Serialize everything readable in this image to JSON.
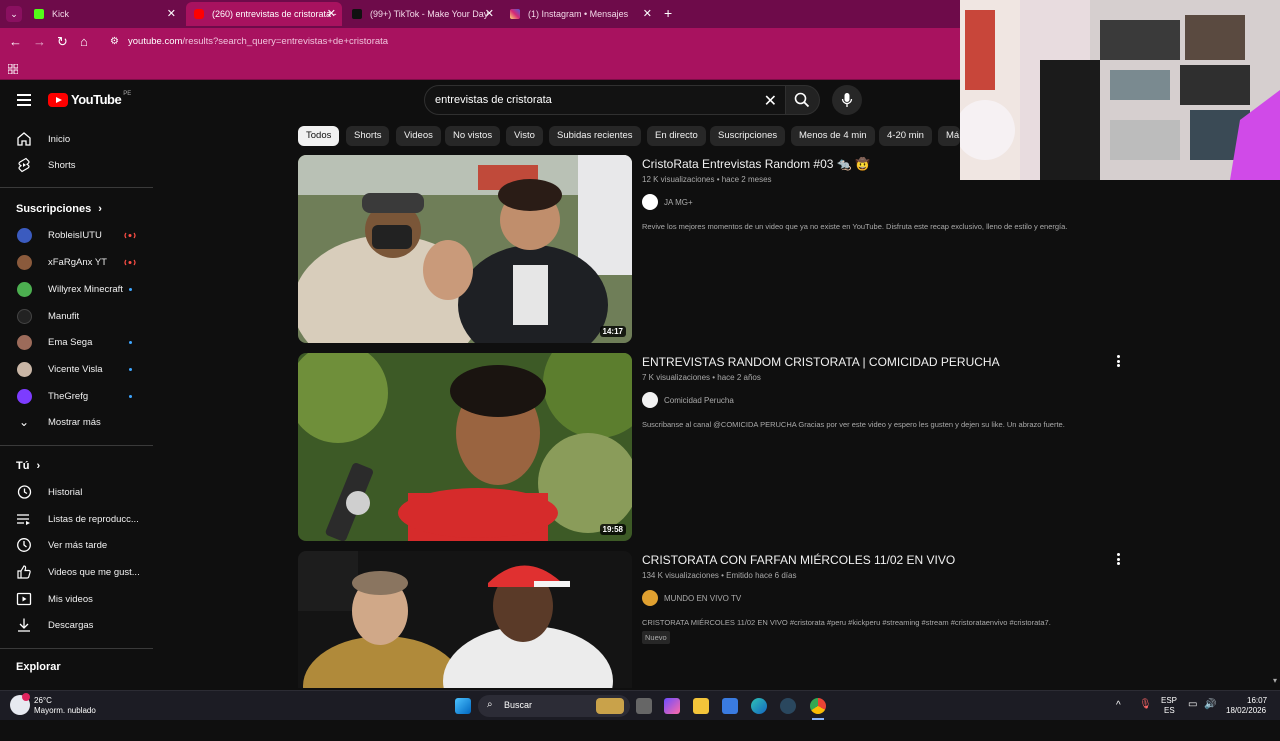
{
  "browser": {
    "tabs": [
      {
        "label": "Kick",
        "active": false,
        "icon_color": "#53fc18"
      },
      {
        "label": "(260) entrevistas de cristorata -",
        "active": true,
        "icon_color": "#ff0000"
      },
      {
        "label": "(99+) TikTok - Make Your Day",
        "active": false,
        "icon_color": "#000000"
      },
      {
        "label": "(1) Instagram • Mensajes",
        "active": false,
        "icon_color": "#d62976"
      }
    ],
    "new_tab": "+",
    "url_host": "youtube.com",
    "url_path": "/results?search_query=entrevistas+de+cristorata",
    "theme_color": "#a8125f"
  },
  "header": {
    "logo_text": "YouTube",
    "region": "PE",
    "search_query": "entrevistas de cristorata"
  },
  "sidebar": {
    "top_items": [
      {
        "label": "Inicio",
        "icon": "home-icon"
      },
      {
        "label": "Shorts",
        "icon": "shorts-icon"
      }
    ],
    "subscriptions_title": "Suscripciones",
    "subscriptions": [
      {
        "label": "RobleisIUTU",
        "indicator": "live",
        "avatar_color": "#3b5bbf"
      },
      {
        "label": "xFaRgAnx YT",
        "indicator": "live",
        "avatar_color": "#8a5a3c"
      },
      {
        "label": "Willyrex Minecraft",
        "indicator": "dot",
        "avatar_color": "#4caf50"
      },
      {
        "label": "Manufit",
        "indicator": "",
        "avatar_color": "#222222"
      },
      {
        "label": "Ema Sega",
        "indicator": "dot",
        "avatar_color": "#9c6b5a"
      },
      {
        "label": "Vicente Visla",
        "indicator": "dot",
        "avatar_color": "#c9b6a6"
      },
      {
        "label": "TheGrefg",
        "indicator": "dot",
        "avatar_color": "#7d3cff"
      },
      {
        "label": "Mostrar más",
        "indicator": "",
        "avatar_color": ""
      }
    ],
    "you_title": "Tú",
    "you_items": [
      {
        "label": "Historial",
        "icon": "history-icon"
      },
      {
        "label": "Listas de reproducc...",
        "icon": "playlists-icon"
      },
      {
        "label": "Ver más tarde",
        "icon": "watch-later-icon"
      },
      {
        "label": "Videos que me gust...",
        "icon": "like-icon"
      },
      {
        "label": "Mis videos",
        "icon": "my-videos-icon"
      },
      {
        "label": "Descargas",
        "icon": "downloads-icon"
      }
    ],
    "explore_title": "Explorar"
  },
  "chips": [
    "Todos",
    "Shorts",
    "Videos",
    "No vistos",
    "Visto",
    "Subidas recientes",
    "En directo",
    "Suscripciones",
    "Menos de 4 min",
    "4-20 min",
    "Má"
  ],
  "results": [
    {
      "title": "CristoRata Entrevistas Random #03 🐀 🤠",
      "meta": "12 K visualizaciones • hace 2 meses",
      "channel": "JA MG+",
      "channel_color": "#ffffff",
      "description": "Revive los mejores momentos de un video que ya no existe en YouTube. Disfruta este recap exclusivo, lleno de estilo y energía.",
      "duration": "14:17",
      "badge": ""
    },
    {
      "title": "ENTREVISTAS RANDOM CRISTORATA | COMICIDAD PERUCHA",
      "meta": "7 K visualizaciones • hace 2 años",
      "channel": "Comicidad Perucha",
      "channel_color": "#f2f2f2",
      "description": "Suscribanse al canal @COMICIDA PERUCHA Gracias por ver este video y espero les gusten y dejen su like. Un abrazo fuerte.",
      "duration": "19:58",
      "badge": ""
    },
    {
      "title": "CRISTORATA CON FARFAN MIÉRCOLES 11/02 EN VIVO",
      "meta": "134 K visualizaciones • Emitido hace 6 días",
      "channel": "MUNDO EN VIVO TV",
      "channel_color": "#e0a030",
      "description": "CRISTORATA MIÉRCOLES 11/02 EN VIVO #cristorata #peru #kickperu #streaming #stream #cristorataenvivo #cristorata7.",
      "duration": "",
      "badge": "Nuevo"
    }
  ],
  "taskbar": {
    "weather_temp": "26°C",
    "weather_desc": "Mayorm. nublado",
    "search_label": "Buscar",
    "lang": "ESP",
    "lang_sub": "ES",
    "time": "16:07",
    "date": "18/02/2026"
  }
}
